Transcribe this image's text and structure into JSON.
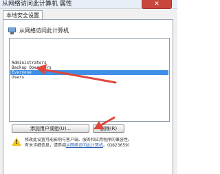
{
  "window": {
    "title": "从网络访问此计算机 属性",
    "close_glyph": "✕"
  },
  "tabs": [
    {
      "label": "本地安全设置"
    }
  ],
  "policy": {
    "name": "从网络访问此计算机",
    "icon": "computer-icon"
  },
  "members": [
    {
      "name": "Administrators",
      "selected": false
    },
    {
      "name": "Backup Operators",
      "selected": false
    },
    {
      "name": "Everyone",
      "selected": true
    },
    {
      "name": "Users",
      "selected": false
    }
  ],
  "buttons": {
    "add_label": "添加用户或组(U)...",
    "remove_label": "删除(R)"
  },
  "note": {
    "icon": "warning-icon",
    "line1": "修改此设置可能影响与客户端、服务和应用程序的兼容性。",
    "line2_prefix": "有关详细信息，请参阅",
    "line2_link": "从网络访问此计算机",
    "line2_suffix": "。(Q823659)"
  },
  "annotations": {
    "arrow_color": "#e0463a"
  }
}
